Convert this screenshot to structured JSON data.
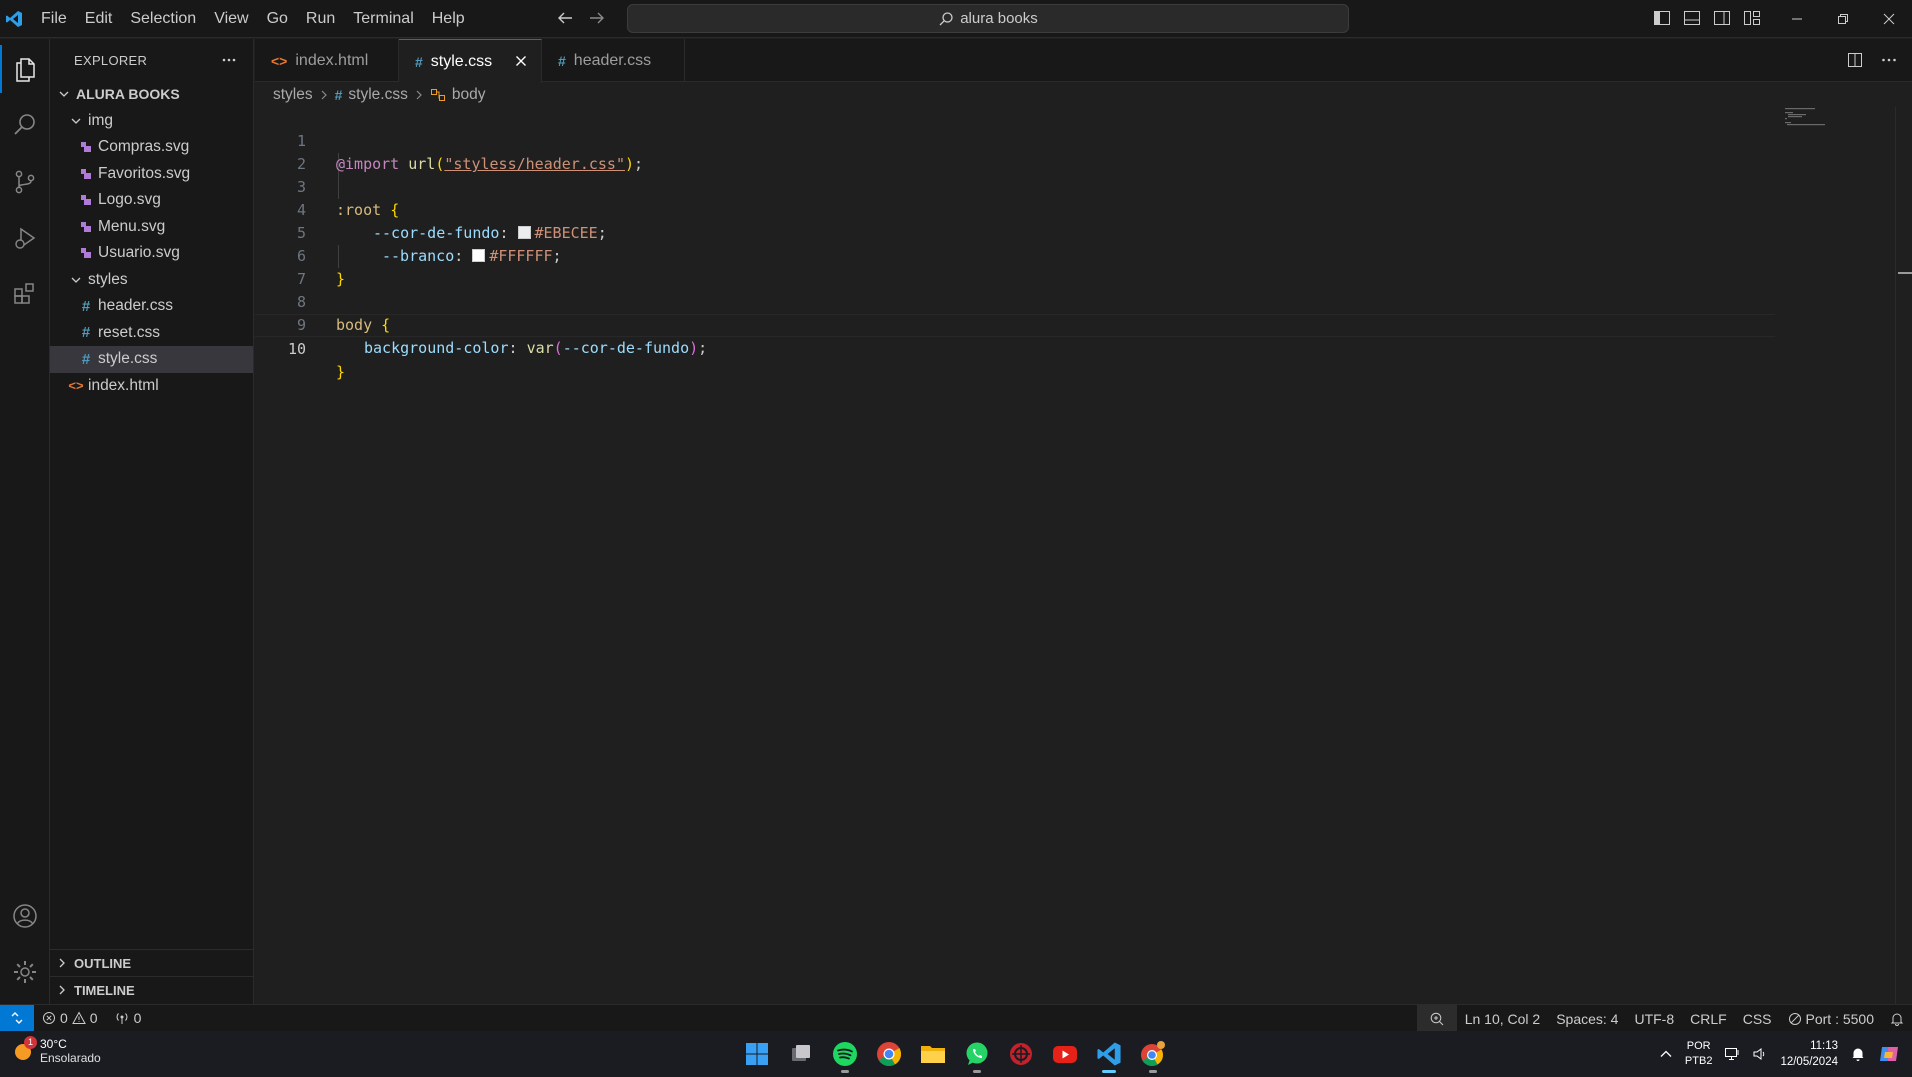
{
  "titlebar": {
    "menu": [
      "File",
      "Edit",
      "Selection",
      "View",
      "Go",
      "Run",
      "Terminal",
      "Help"
    ],
    "search_text": "alura books"
  },
  "sidebar": {
    "title": "EXPLORER",
    "root": "ALURA BOOKS",
    "tree": [
      {
        "label": "img",
        "kind": "folder"
      },
      {
        "label": "Compras.svg",
        "kind": "svg"
      },
      {
        "label": "Favoritos.svg",
        "kind": "svg"
      },
      {
        "label": "Logo.svg",
        "kind": "svg"
      },
      {
        "label": "Menu.svg",
        "kind": "svg"
      },
      {
        "label": "Usuario.svg",
        "kind": "svg"
      },
      {
        "label": "styles",
        "kind": "folder"
      },
      {
        "label": "header.css",
        "kind": "css"
      },
      {
        "label": "reset.css",
        "kind": "css"
      },
      {
        "label": "style.css",
        "kind": "css",
        "selected": true
      },
      {
        "label": "index.html",
        "kind": "html"
      }
    ],
    "outline": "OUTLINE",
    "timeline": "TIMELINE"
  },
  "tabs": [
    {
      "label": "index.html",
      "icon": "<>"
    },
    {
      "label": "style.css",
      "icon": "#",
      "active": true
    },
    {
      "label": "header.css",
      "icon": "#"
    }
  ],
  "breadcrumb": [
    "styles",
    "style.css",
    "body"
  ],
  "editor": {
    "line_numbers": [
      "1",
      "2",
      "3",
      "4",
      "5",
      "6",
      "7",
      "8",
      "9",
      "10"
    ],
    "current_line": "10",
    "tokens": {
      "l1_at": "@import",
      "l1_fn": "url",
      "l1_str": "\"styless/header.css\"",
      "l1_end": ";",
      "l3_sel": ":root",
      "l4_prop": "--cor-de-fundo",
      "l4_val": "#EBECEE",
      "l5_prop": "--branco",
      "l5_val": "#FFFFFF",
      "l8_sel": "body",
      "l9_prop": "background-color",
      "l9_fn": "var",
      "l9_arg": "--cor-de-fundo",
      "open_brace": "{",
      "close_brace": "}"
    },
    "swatch_colors": [
      "#EBECEE",
      "#FFFFFF"
    ]
  },
  "statusbar": {
    "errors": "0",
    "warnings": "0",
    "ports": "0",
    "position": "Ln 10, Col 2",
    "spaces": "Spaces: 4",
    "encoding": "UTF-8",
    "eol": "CRLF",
    "language": "CSS",
    "port": "Port : 5500"
  },
  "taskbar": {
    "weather_temp": "30°C",
    "weather_cond": "Ensolarado",
    "weather_badge": "1",
    "lang_line1": "POR",
    "lang_line2": "PTB2",
    "time": "11:13",
    "date": "12/05/2024"
  },
  "colors": {
    "accent": "#0078d4",
    "editor_bg": "#1f1f1f",
    "chrome_bg": "#181818"
  }
}
